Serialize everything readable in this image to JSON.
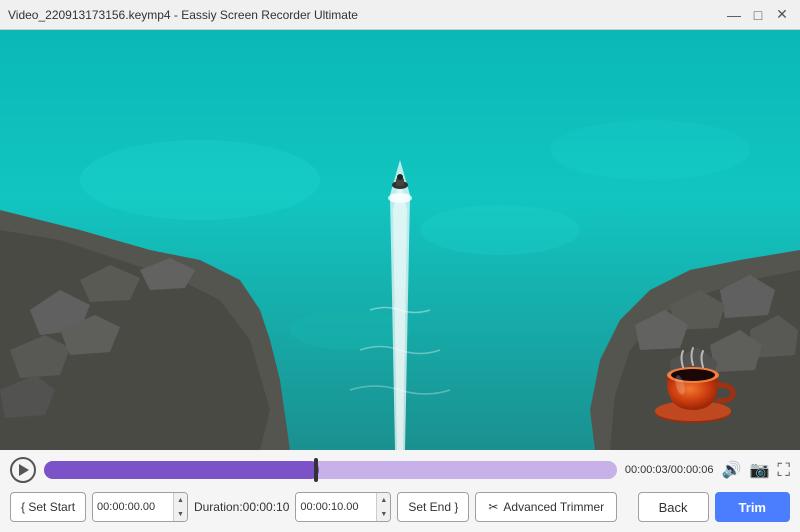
{
  "titleBar": {
    "title": "Video_220913173156.keymp4  -  Eassiy Screen Recorder Ultimate",
    "minimize": "—",
    "maximize": "□",
    "close": "✕"
  },
  "timeline": {
    "currentTime": "00:00:03",
    "totalTime": "00:00:06",
    "fillPercent": 48
  },
  "controls": {
    "setStart": "{ Set Start",
    "startTime": "00:00:00.00",
    "durationLabel": "Duration:00:00:10",
    "endTime": "00:00:10.00",
    "setEnd": "Set End }",
    "advancedTrimmer": "Advanced Trimmer",
    "back": "Back",
    "trim": "Trim"
  },
  "icons": {
    "play": "▶",
    "volume": "🔊",
    "camera": "📷",
    "fullscreen": "⛶",
    "scissors": "✂"
  }
}
